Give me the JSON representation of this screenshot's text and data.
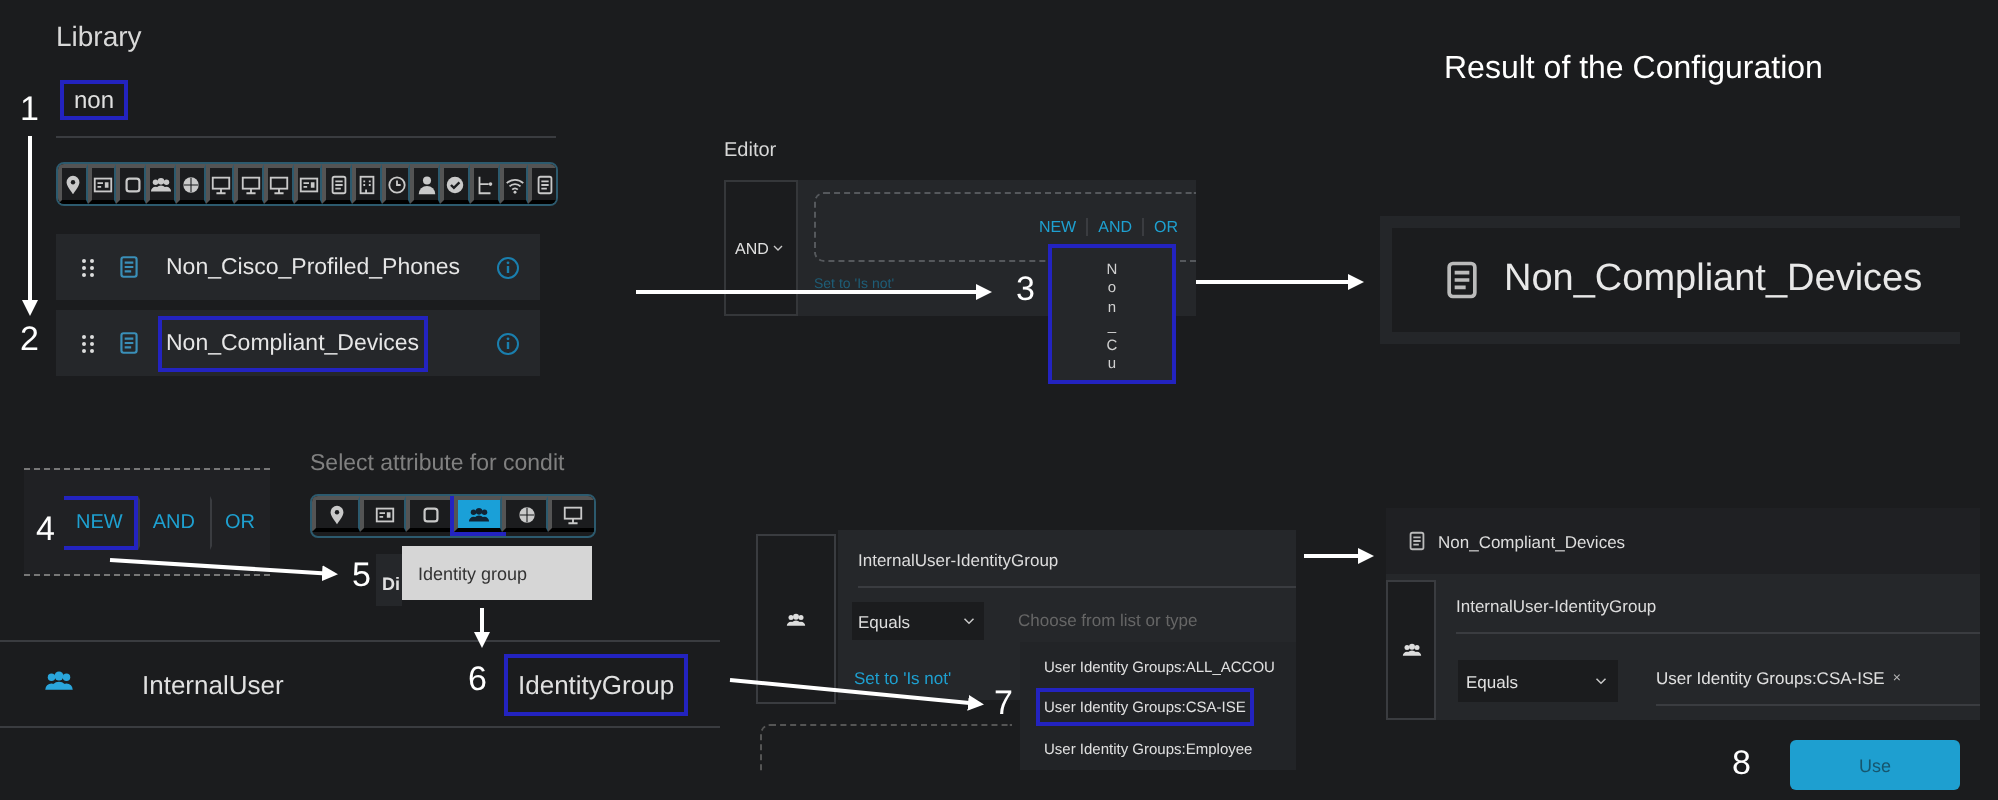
{
  "library": {
    "title": "Library",
    "search": {
      "value": "non",
      "highlighted": true
    },
    "items": [
      {
        "label": "Non_Cisco_Profiled_Phones",
        "highlighted": false
      },
      {
        "label": "Non_Compliant_Devices",
        "highlighted": true
      }
    ]
  },
  "editor": {
    "title": "Editor",
    "operator": "AND",
    "actions": [
      "NEW",
      "AND",
      "OR"
    ],
    "set_not_link": "Set to 'Is not'",
    "dragged_item": "Non_Cu"
  },
  "result": {
    "title": "Result of the Configuration",
    "condition": "Non_Compliant_Devices"
  },
  "new_condition": {
    "actions": [
      {
        "label": "NEW",
        "highlighted": true
      },
      {
        "label": "AND",
        "highlighted": false
      },
      {
        "label": "OR",
        "highlighted": false
      }
    ],
    "attribute_prompt": "Select attribute for condit",
    "attribute_tabs": [
      {
        "selected": false
      },
      {
        "selected": false
      },
      {
        "selected": false
      },
      {
        "selected": true
      },
      {
        "selected": false
      },
      {
        "selected": false
      }
    ],
    "tooltip": "Identity group",
    "row_fragment": "Di",
    "dictionary_row": {
      "dictionary": "InternalUser",
      "attribute": "IdentityGroup",
      "highlighted": true
    }
  },
  "condition_editor": {
    "attribute": "InternalUser-IdentityGroup",
    "operator": "Equals",
    "value": {
      "placeholder": "Choose from list or type"
    },
    "set_not_link": "Set to 'Is not'",
    "options": [
      {
        "label": "User Identity Groups:ALL_ACCOU",
        "selected": false
      },
      {
        "label": "User Identity Groups:CSA-ISE",
        "selected": true
      },
      {
        "label": "User Identity Groups:Employee",
        "selected": false
      }
    ]
  },
  "final_condition": {
    "name": "Non_Compliant_Devices",
    "attribute": "InternalUser-IdentityGroup",
    "operator": "Equals",
    "value": "User Identity Groups:CSA-ISE",
    "remove": "×"
  },
  "use_button": "Use",
  "steps": [
    "1",
    "2",
    "3",
    "4",
    "5",
    "6",
    "7",
    "8"
  ]
}
